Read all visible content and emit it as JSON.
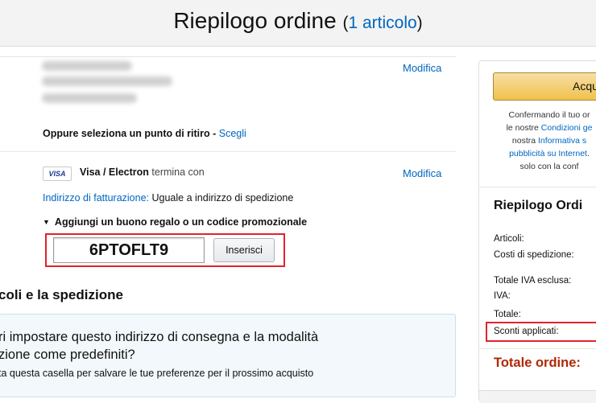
{
  "header": {
    "title": "Riepilogo ordine",
    "count_open": "(",
    "count_link": "1 articolo",
    "count_close": ")"
  },
  "shipping": {
    "edit_label": "Modifica",
    "pickup_text": "Oppure seleziona un punto di ritiro - ",
    "pickup_link": "Scegli"
  },
  "payment": {
    "card_brand_badge": "VISA",
    "card_name": "Visa / Electron",
    "card_suffix": "termina con",
    "edit_label": "Modifica",
    "billing_label": "Indirizzo di fatturazione:",
    "billing_value": "Uguale a indirizzo di spedizione",
    "gift_toggle_label": "Aggiungi un buono regalo o un codice promozionale",
    "promo_code_value": "6PTOFLT9",
    "apply_button": "Inserisci"
  },
  "items_section": {
    "title": "coli e la spedizione",
    "pref_question_line1": "ri impostare questo indirizzo di consegna e la modalità",
    "pref_question_line2": "zione come predefiniti?",
    "pref_note": "ta questa casella per salvare le tue preferenze per il prossimo acquisto"
  },
  "sidebar": {
    "buy_button": "Acqu",
    "legal_line1": "Confermando il tuo or",
    "legal_line2_pre": "le nostre ",
    "legal_line2_link": "Condizioni ge",
    "legal_line3_pre": "nostra ",
    "legal_line3_link": "Informativa s",
    "legal_line4_link": "pubblicità su Internet",
    "legal_line4_post": ".",
    "legal_line5": "solo con la conf",
    "summary_title": "Riepilogo Ordi",
    "rows": {
      "articoli": "Articoli:",
      "spedizione": "Costi di spedizione:",
      "iva_esclusa": "Totale IVA esclusa:",
      "iva": "IVA:",
      "totale": "Totale:",
      "sconti": "Sconti applicati:"
    },
    "order_total": "Totale ordine:"
  },
  "colors": {
    "link": "#0066c0",
    "highlight": "#e0232d",
    "total": "#b12704",
    "buy_button": "#f0c14b"
  }
}
